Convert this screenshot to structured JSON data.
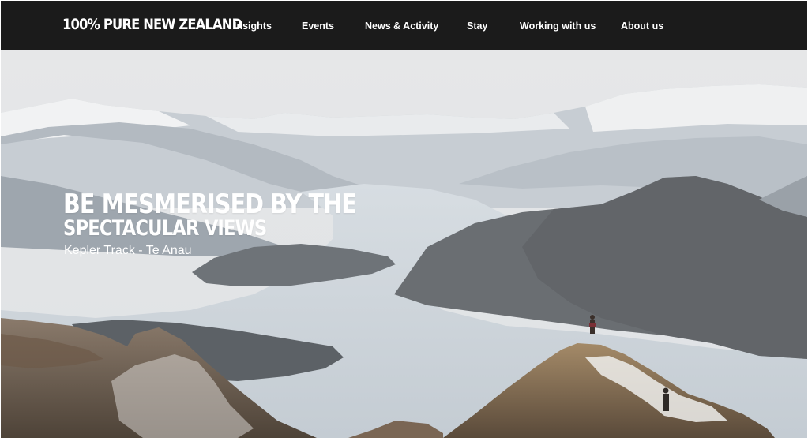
{
  "brand": {
    "logo_text": "100% PURE NEW ZEALAND"
  },
  "nav": {
    "items": [
      {
        "label": "Insights"
      },
      {
        "label": "Events"
      },
      {
        "label": "News & Activity"
      },
      {
        "label": "Stay"
      },
      {
        "label": "Working with us"
      },
      {
        "label": "About us"
      }
    ]
  },
  "hero": {
    "title_line1": "BE MESMERISED BY THE",
    "title_line2": "SPECTACULAR VIEWS",
    "subtitle": "Kepler Track - Te Anau"
  },
  "colors": {
    "navbar_bg": "#1b1b1b",
    "nav_text": "#ffffff",
    "hero_text": "#ffffff"
  }
}
